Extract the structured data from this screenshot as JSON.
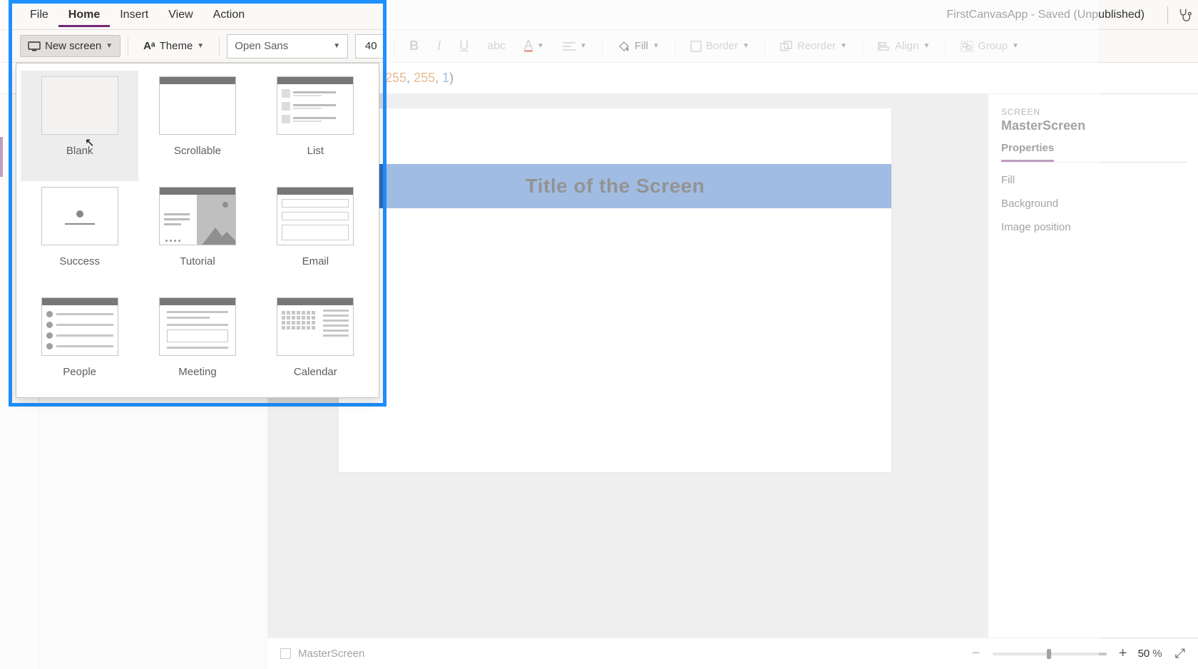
{
  "app_title": "FirstCanvasApp - Saved (Unpublished)",
  "menu": {
    "file": "File",
    "home": "Home",
    "insert": "Insert",
    "view": "View",
    "action": "Action"
  },
  "ribbon": {
    "new_screen": "New screen",
    "theme": "Theme",
    "font_name": "Open Sans",
    "font_size": "40",
    "fill": "Fill",
    "border": "Border",
    "reorder": "Reorder",
    "align": "Align",
    "group": "Group"
  },
  "formula": {
    "part1": "255",
    "part2": "255",
    "part3": "1",
    "static_prefix": ", ",
    "static_mid": ", ",
    "static_suffix": ")"
  },
  "templates": [
    {
      "key": "blank",
      "label": "Blank"
    },
    {
      "key": "scrollable",
      "label": "Scrollable"
    },
    {
      "key": "list",
      "label": "List"
    },
    {
      "key": "success",
      "label": "Success"
    },
    {
      "key": "tutorial",
      "label": "Tutorial"
    },
    {
      "key": "email",
      "label": "Email"
    },
    {
      "key": "people",
      "label": "People"
    },
    {
      "key": "meeting",
      "label": "Meeting"
    },
    {
      "key": "calendar",
      "label": "Calendar"
    }
  ],
  "canvas": {
    "header_text": "Title of the Screen"
  },
  "properties": {
    "category": "SCREEN",
    "object_name": "MasterScreen",
    "tab_properties": "Properties",
    "rows": {
      "fill": "Fill",
      "background": "Background",
      "image_position": "Image position"
    }
  },
  "statusbar": {
    "screen_name": "MasterScreen",
    "zoom_value": "50",
    "zoom_unit": "%"
  }
}
